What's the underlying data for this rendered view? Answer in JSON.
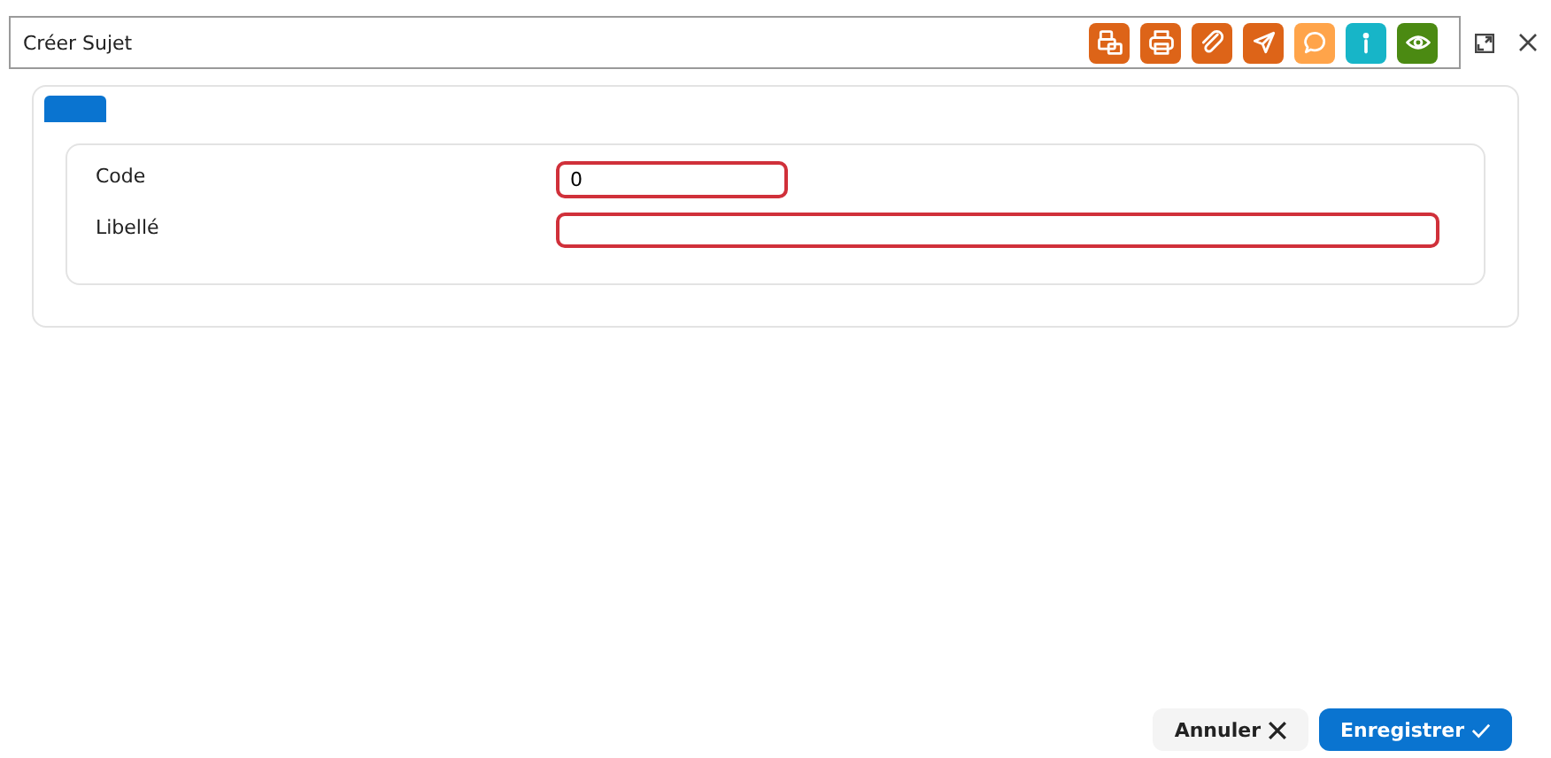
{
  "window": {
    "title": "Créer Sujet"
  },
  "toolbar": [
    {
      "kind": "fax",
      "color": "#dd6418"
    },
    {
      "kind": "print",
      "color": "#dd6418"
    },
    {
      "kind": "attach",
      "color": "#dd6418"
    },
    {
      "kind": "send",
      "color": "#dd6418"
    },
    {
      "kind": "comment",
      "color": "#ffa44a"
    },
    {
      "kind": "info",
      "color": "#17b5c8"
    },
    {
      "kind": "view",
      "color": "#4b8a12"
    }
  ],
  "tabs": [
    {
      "selected": true
    }
  ],
  "fields": [
    {
      "label": "Code",
      "value": "0",
      "invalid": true,
      "kind": "number"
    },
    {
      "label": "Libellé",
      "invalid": true,
      "kind": "text"
    }
  ],
  "buttons": [
    {
      "kind": "cancel",
      "label": "Annuler"
    },
    {
      "kind": "save",
      "label": "Enregistrer"
    }
  ]
}
